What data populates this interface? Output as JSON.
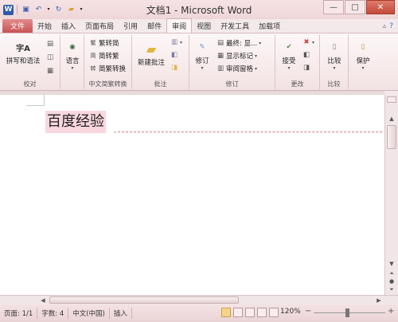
{
  "window": {
    "title": "文档1 - Microsoft Word"
  },
  "tabs": {
    "file": "文件",
    "items": [
      "开始",
      "插入",
      "页面布局",
      "引用",
      "邮件",
      "审阅",
      "视图",
      "开发工具",
      "加载项"
    ],
    "active": "审阅"
  },
  "ribbon": {
    "proofing": {
      "label": "校对",
      "spelling": "拼写和语法",
      "spelling_icon_text": "字A"
    },
    "language": {
      "label": "语言"
    },
    "chinese": {
      "label": "中文简繁转换",
      "to_traditional": "繁转简",
      "to_simplified": "简转繁",
      "convert": "简繁转换"
    },
    "comments": {
      "label": "批注",
      "new_comment": "新建批注"
    },
    "tracking": {
      "label": "修订",
      "track_changes": "修订",
      "final_show": "最终: 显...",
      "show_markup": "显示标记",
      "review_pane": "审阅窗格"
    },
    "changes": {
      "label": "更改",
      "accept": "接受"
    },
    "compare": {
      "label": "比较",
      "compare": "比较"
    },
    "protect": {
      "label": "",
      "protect": "保护"
    }
  },
  "document": {
    "text": "百度经验"
  },
  "status": {
    "page": "页面: 1/1",
    "words": "字数: 4",
    "language": "中文(中国)",
    "mode": "插入",
    "zoom": "120%"
  },
  "colors": {
    "accent": "#c65454",
    "revision_highlight": "#f9d7de"
  }
}
